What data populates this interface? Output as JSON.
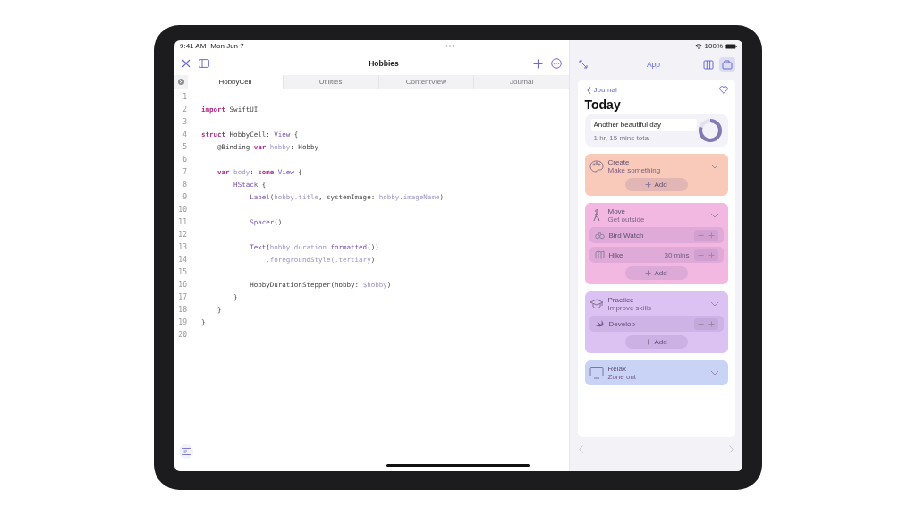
{
  "status_bar": {
    "time": "9:41 AM",
    "date": "Mon Jun 7",
    "battery": "100%"
  },
  "editor": {
    "title": "Hobbies",
    "tabs": [
      {
        "label": "HobbyCell",
        "selected": true
      },
      {
        "label": "Utilities",
        "selected": false
      },
      {
        "label": "ContentView",
        "selected": false
      },
      {
        "label": "Journal",
        "selected": false
      }
    ],
    "lines": [
      {
        "num": "1"
      },
      {
        "num": "2",
        "tokens": [
          {
            "kind": "keyword",
            "text": "import"
          },
          {
            "kind": "plain",
            "text": " SwiftUI"
          }
        ]
      },
      {
        "num": "3"
      },
      {
        "num": "4",
        "tokens": [
          {
            "kind": "keyword",
            "text": "struct"
          },
          {
            "kind": "plain",
            "text": " HobbyCell: "
          },
          {
            "kind": "type",
            "text": "View"
          },
          {
            "kind": "plain",
            "text": " {"
          }
        ]
      },
      {
        "num": "5",
        "tokens": [
          {
            "kind": "plain",
            "text": "    @Binding "
          },
          {
            "kind": "keyword",
            "text": "var"
          },
          {
            "kind": "property",
            "text": " hobby"
          },
          {
            "kind": "plain",
            "text": ": Hobby"
          }
        ]
      },
      {
        "num": "6"
      },
      {
        "num": "7",
        "tokens": [
          {
            "kind": "keyword",
            "text": "    var"
          },
          {
            "kind": "property",
            "text": " body"
          },
          {
            "kind": "plain",
            "text": ": "
          },
          {
            "kind": "keyword",
            "text": "some"
          },
          {
            "kind": "type",
            "text": " View"
          },
          {
            "kind": "plain",
            "text": " {"
          }
        ]
      },
      {
        "num": "8",
        "tokens": [
          {
            "kind": "type",
            "text": "        HStack"
          },
          {
            "kind": "plain",
            "text": " {"
          }
        ]
      },
      {
        "num": "9",
        "tokens": [
          {
            "kind": "type",
            "text": "            Label"
          },
          {
            "kind": "plain",
            "text": "("
          },
          {
            "kind": "property",
            "text": "hobby.title"
          },
          {
            "kind": "plain",
            "text": ", systemImage: "
          },
          {
            "kind": "property",
            "text": "hobby.imageName"
          },
          {
            "kind": "plain",
            "text": ")"
          }
        ]
      },
      {
        "num": "10"
      },
      {
        "num": "11",
        "tokens": [
          {
            "kind": "type",
            "text": "            Spacer"
          },
          {
            "kind": "plain",
            "text": "()"
          }
        ]
      },
      {
        "num": "12"
      },
      {
        "num": "13",
        "tokens": [
          {
            "kind": "type",
            "text": "            Text"
          },
          {
            "kind": "plain",
            "text": "("
          },
          {
            "kind": "property",
            "text": "hobby.duration."
          },
          {
            "kind": "type",
            "text": "formatted"
          },
          {
            "kind": "plain",
            "text": "())"
          }
        ]
      },
      {
        "num": "14",
        "tokens": [
          {
            "kind": "property",
            "text": "                .foregroundStyle(.tertiary"
          },
          {
            "kind": "plain",
            "text": ")"
          }
        ]
      },
      {
        "num": "15"
      },
      {
        "num": "16",
        "tokens": [
          {
            "kind": "plain",
            "text": "            HobbyDurationStepper(hobby: "
          },
          {
            "kind": "property",
            "text": "$hobby"
          },
          {
            "kind": "plain",
            "text": ")"
          }
        ]
      },
      {
        "num": "17",
        "tokens": [
          {
            "kind": "plain",
            "text": "        }"
          }
        ]
      },
      {
        "num": "18",
        "tokens": [
          {
            "kind": "plain",
            "text": "    }"
          }
        ]
      },
      {
        "num": "19",
        "tokens": [
          {
            "kind": "plain",
            "text": "}"
          }
        ]
      },
      {
        "num": "20"
      }
    ]
  },
  "preview": {
    "title": "App",
    "back": "Journal",
    "heading": "Today",
    "summary": {
      "value": "Another beautiful day",
      "total": "1 hr, 15 mins total",
      "level": 0.8
    },
    "categories": [
      {
        "name": "Create",
        "subtitle": "Make something",
        "color": "#f9c9b9",
        "expanded": true,
        "add": "Add"
      },
      {
        "name": "Move",
        "subtitle": "Get outside",
        "color": "#f2b8e2",
        "expanded": true,
        "items": [
          {
            "name": "Bird Watch"
          },
          {
            "name": "Hike",
            "duration": "30 mins"
          }
        ],
        "add": "Add"
      },
      {
        "name": "Practice",
        "subtitle": "Improve skills",
        "color": "#dcc2f3",
        "expanded": true,
        "items": [
          {
            "name": "Develop"
          }
        ],
        "add": "Add"
      },
      {
        "name": "Relax",
        "subtitle": "Zone out",
        "color": "#c8d3f6",
        "expanded": true
      }
    ]
  }
}
